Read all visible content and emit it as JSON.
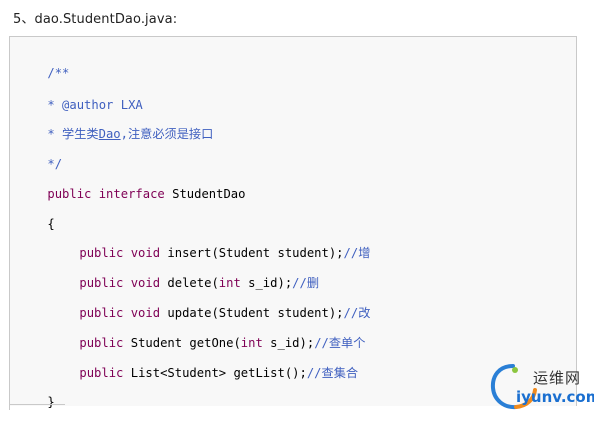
{
  "heading": "5、dao.StudentDao.java:",
  "code": {
    "line1": "/**",
    "line2": "* @author LXA",
    "line3_prefix": "* 学生类",
    "line3_link": "Dao",
    "line3_suffix": ",注意必须是接口",
    "line4": "*/",
    "line5_kw": "public interface",
    "line5_rest": " StudentDao",
    "line6": "{",
    "line7_kw": "public void",
    "line7_rest": " insert(Student student);",
    "line7_comment": "//增",
    "line8_kw": "public void",
    "line8_mid": " delete(",
    "line8_kw2": "int",
    "line8_rest": " s_id);",
    "line8_comment": "//删",
    "line9_kw": "public void",
    "line9_rest": " update(Student student);",
    "line9_comment": "//改",
    "line10_kw": "public",
    "line10_mid": " Student getOne(",
    "line10_kw2": "int",
    "line10_rest": " s_id);",
    "line10_comment": "//查单个",
    "line11_kw": "public",
    "line11_rest": " List<Student> getList();",
    "line11_comment": "//查集合",
    "line12": "}"
  },
  "watermark": {
    "top": "运维网",
    "bottom": "iyunv.com"
  },
  "colors": {
    "comment": "#3f5fbf",
    "keyword": "#7f0055",
    "box_background": "#f8f8f8",
    "box_border": "#c9c9c9",
    "logo_blue": "#1a6fd0"
  }
}
